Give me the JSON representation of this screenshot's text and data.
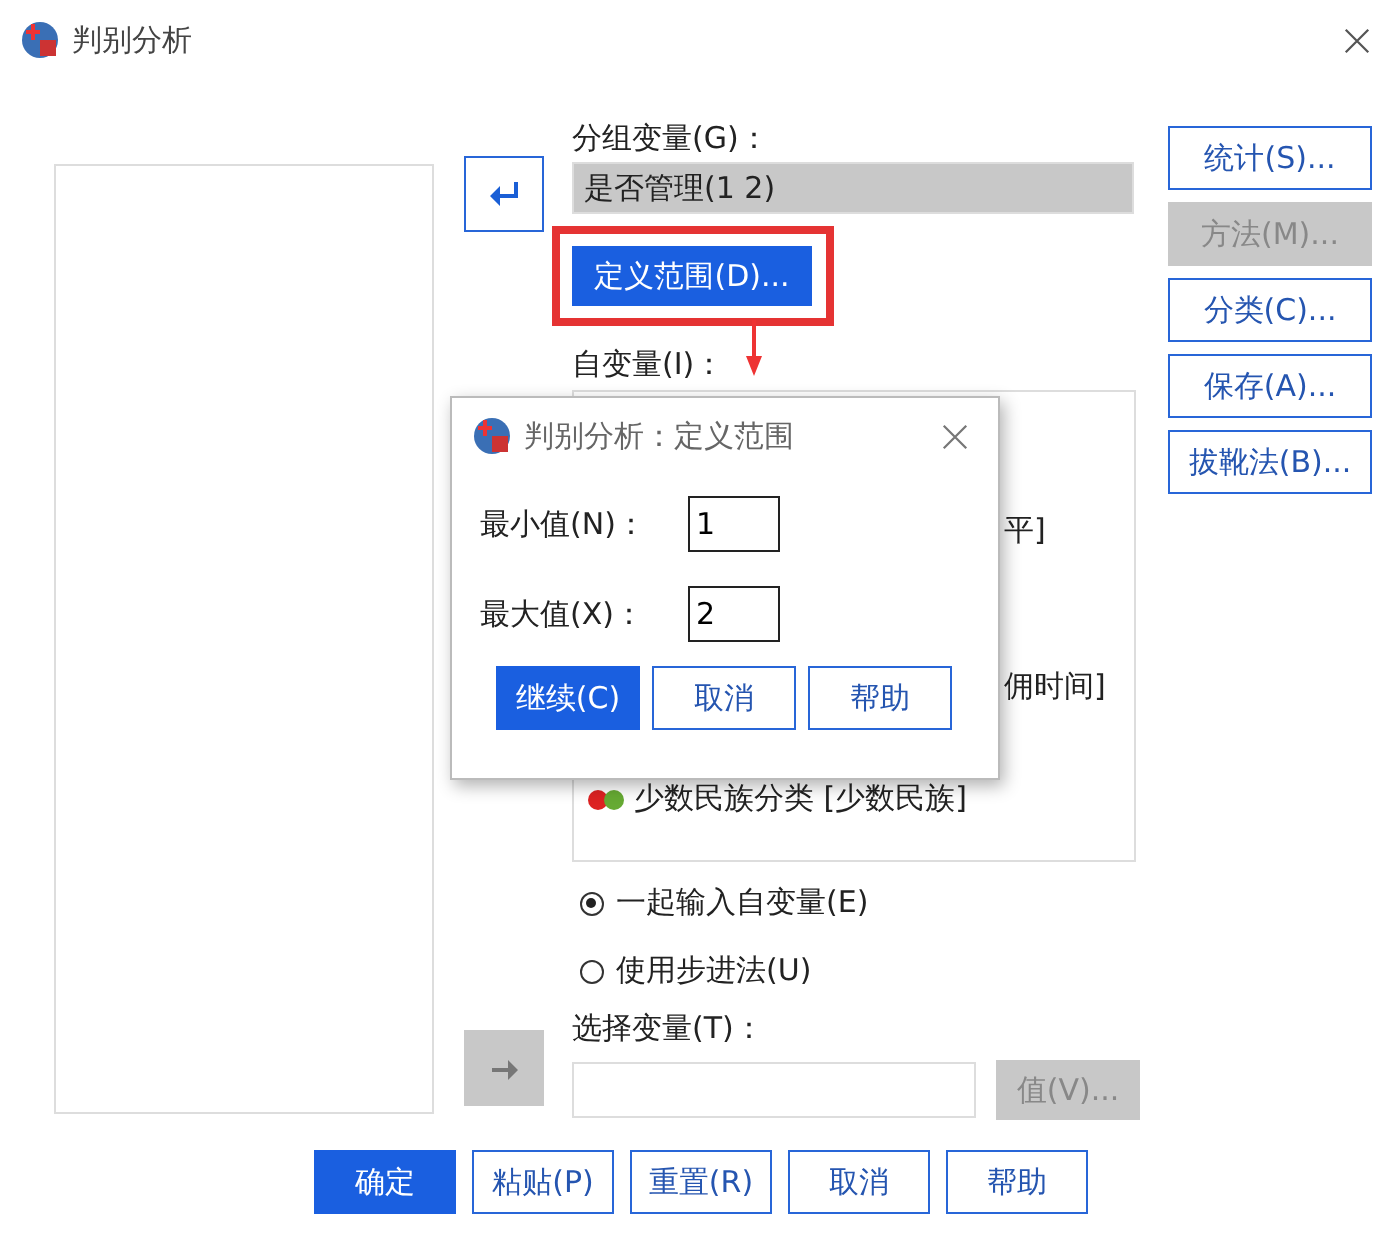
{
  "window": {
    "title": "判别分析"
  },
  "grouping": {
    "label": "分组变量(G)：",
    "value": "是否管理(1 2)",
    "define_button": {
      "label": "定义范围(D)...",
      "highlighted": true
    }
  },
  "independent": {
    "label": "自变量(I)：",
    "items": [
      {
        "text": "平]",
        "kind": "fragment"
      },
      {
        "text": "佣时间]",
        "kind": "fragment"
      },
      {
        "text": "少数民族分类 [少数民族]",
        "kind": "nominal"
      }
    ]
  },
  "methods": [
    {
      "label": "一起输入自变量(E)",
      "selected": true
    },
    {
      "label": "使用步进法(U)",
      "selected": false
    }
  ],
  "selection": {
    "label": "选择变量(T)：",
    "value_button": {
      "label": "值(V)...",
      "disabled": true
    }
  },
  "side_buttons": [
    {
      "label": "统计(S)...",
      "disabled": false
    },
    {
      "label": "方法(M)...",
      "disabled": true
    },
    {
      "label": "分类(C)...",
      "disabled": false
    },
    {
      "label": "保存(A)...",
      "disabled": false
    },
    {
      "label": "拔靴法(B)...",
      "disabled": false
    }
  ],
  "bottom_buttons": [
    {
      "label": "确定",
      "primary": true
    },
    {
      "label": "粘贴(P)",
      "primary": false
    },
    {
      "label": "重置(R)",
      "primary": false
    },
    {
      "label": "取消",
      "primary": false
    },
    {
      "label": "帮助",
      "primary": false
    }
  ],
  "popup": {
    "title": "判别分析：定义范围",
    "fields": [
      {
        "label": "最小值(N)：",
        "value": "1"
      },
      {
        "label": "最大值(X)：",
        "value": "2"
      }
    ],
    "buttons": [
      {
        "label": "继续(C)",
        "primary": true
      },
      {
        "label": "取消",
        "primary": false
      },
      {
        "label": "帮助",
        "primary": false
      }
    ]
  }
}
